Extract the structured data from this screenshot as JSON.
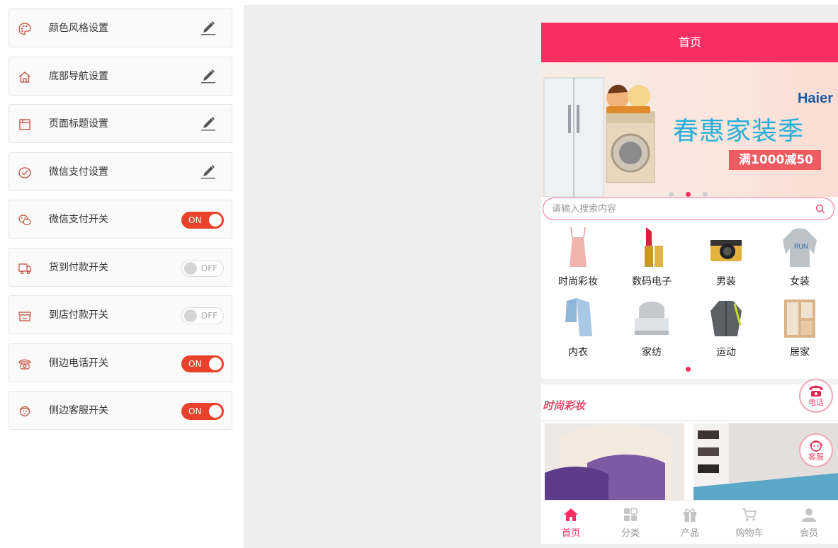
{
  "settings": {
    "items": [
      {
        "label": "颜色风格设置",
        "icon": "palette-icon",
        "control": "edit"
      },
      {
        "label": "底部导航设置",
        "icon": "home-icon",
        "control": "edit"
      },
      {
        "label": "页面标题设置",
        "icon": "page-icon",
        "control": "edit"
      },
      {
        "label": "微信支付设置",
        "icon": "check-circle-icon",
        "control": "edit"
      },
      {
        "label": "微信支付开关",
        "icon": "wechat-icon",
        "control": "toggle",
        "state": "ON"
      },
      {
        "label": "货到付款开关",
        "icon": "delivery-truck-icon",
        "control": "toggle",
        "state": "OFF"
      },
      {
        "label": "到店付款开关",
        "icon": "store-icon",
        "control": "toggle",
        "state": "OFF"
      },
      {
        "label": "侧边电话开关",
        "icon": "telephone-icon",
        "control": "toggle",
        "state": "ON"
      },
      {
        "label": "侧边客服开关",
        "icon": "customer-service-icon",
        "control": "toggle",
        "state": "ON"
      }
    ]
  },
  "phone": {
    "header_title": "首页",
    "banner": {
      "brand": "Haier",
      "title": "春惠家装季",
      "promo": "满1000减50",
      "dots": 3,
      "active_dot": 2
    },
    "search": {
      "placeholder": "请输入搜索内容"
    },
    "categories": [
      {
        "label": "时尚彩妆",
        "icon": "camisole-icon"
      },
      {
        "label": "数码电子",
        "icon": "lipstick-icon"
      },
      {
        "label": "男装",
        "icon": "camera-icon"
      },
      {
        "label": "女装",
        "icon": "hoodie-icon"
      },
      {
        "label": "内衣",
        "icon": "pajamas-icon"
      },
      {
        "label": "家纺",
        "icon": "bed-icon"
      },
      {
        "label": "运动",
        "icon": "jacket-icon"
      },
      {
        "label": "居家",
        "icon": "wardrobe-icon"
      }
    ],
    "section_title": "时尚彩妆",
    "float_buttons": {
      "phone": "电话",
      "service": "客服"
    },
    "tabs": [
      {
        "label": "首页",
        "icon": "home-icon",
        "active": true
      },
      {
        "label": "分类",
        "icon": "grid-icon",
        "active": false
      },
      {
        "label": "产品",
        "icon": "gift-icon",
        "active": false
      },
      {
        "label": "购物车",
        "icon": "cart-icon",
        "active": false
      },
      {
        "label": "会员",
        "icon": "user-icon",
        "active": false
      }
    ]
  },
  "colors": {
    "accent": "#fb2e63",
    "toggle_on": "#e8412c",
    "canvas": "#eeeeee"
  }
}
